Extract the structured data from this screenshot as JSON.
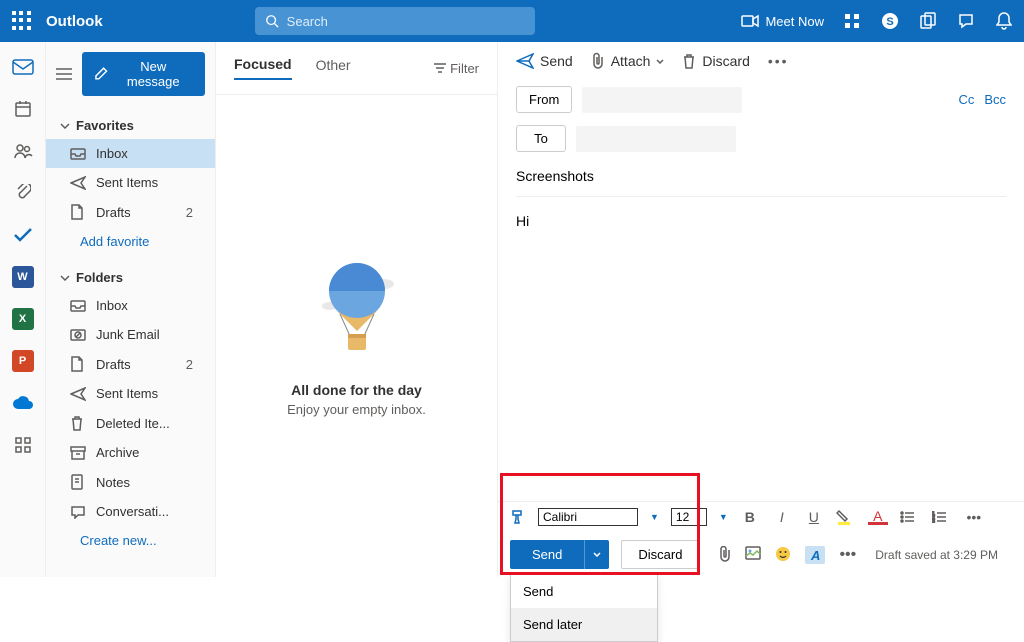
{
  "header": {
    "app_name": "Outlook",
    "search_placeholder": "Search",
    "meet_now": "Meet Now"
  },
  "sidebar": {
    "new_message": "New message",
    "favorites_label": "Favorites",
    "favorites": [
      {
        "icon": "inbox",
        "label": "Inbox",
        "count": "",
        "selected": true
      },
      {
        "icon": "sent",
        "label": "Sent Items",
        "count": ""
      },
      {
        "icon": "draft",
        "label": "Drafts",
        "count": "2"
      }
    ],
    "add_favorite": "Add favorite",
    "folders_label": "Folders",
    "folders": [
      {
        "icon": "inbox",
        "label": "Inbox",
        "count": ""
      },
      {
        "icon": "junk",
        "label": "Junk Email",
        "count": ""
      },
      {
        "icon": "draft",
        "label": "Drafts",
        "count": "2"
      },
      {
        "icon": "sent",
        "label": "Sent Items",
        "count": ""
      },
      {
        "icon": "trash",
        "label": "Deleted Ite...",
        "count": ""
      },
      {
        "icon": "archive",
        "label": "Archive",
        "count": ""
      },
      {
        "icon": "notes",
        "label": "Notes",
        "count": ""
      },
      {
        "icon": "conv",
        "label": "Conversati...",
        "count": ""
      }
    ],
    "create_new": "Create new..."
  },
  "msglist": {
    "tab_focused": "Focused",
    "tab_other": "Other",
    "filter": "Filter",
    "empty_title": "All done for the day",
    "empty_subtitle": "Enjoy your empty inbox."
  },
  "compose": {
    "toolbar": {
      "send": "Send",
      "attach": "Attach",
      "discard": "Discard"
    },
    "from_label": "From",
    "to_label": "To",
    "cc": "Cc",
    "bcc": "Bcc",
    "subject": "Screenshots",
    "body": "Hi",
    "font": "Calibri",
    "font_size": "12",
    "send_btn": "Send",
    "discard_btn": "Discard",
    "dropdown": {
      "send": "Send",
      "send_later": "Send later"
    },
    "draft_status": "Draft saved at 3:29 PM"
  }
}
